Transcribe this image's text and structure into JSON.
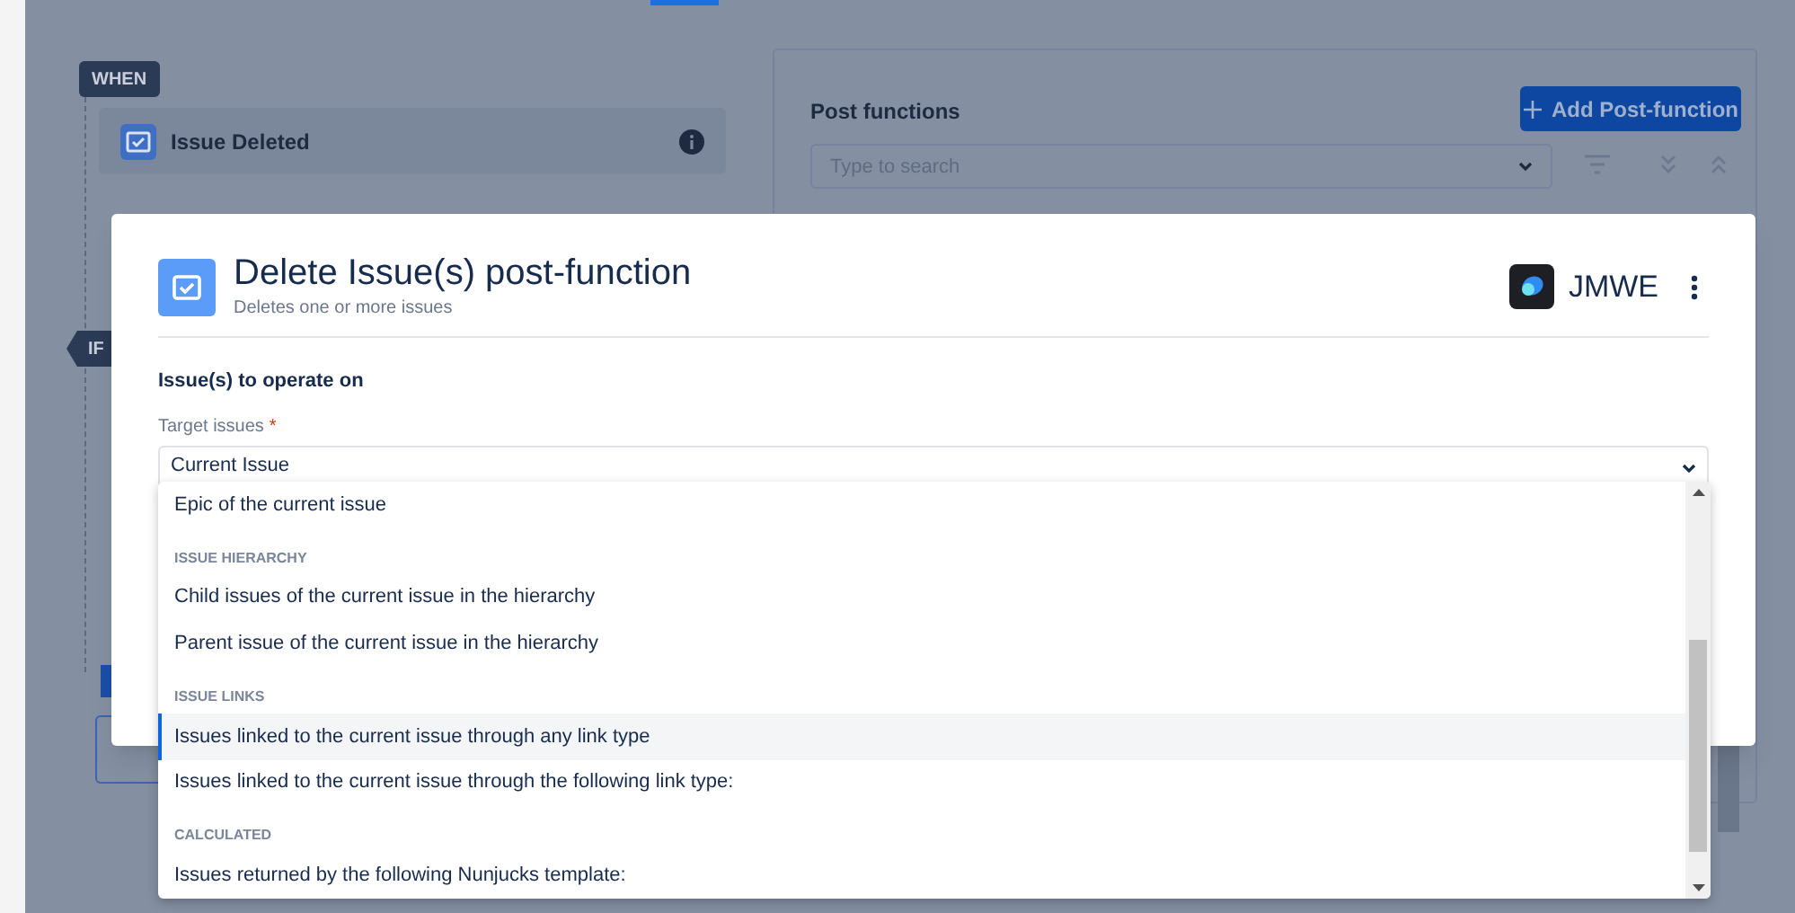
{
  "background": {
    "when_badge": "WHEN",
    "trigger": {
      "title": "Issue Deleted"
    },
    "if_badge": "IF",
    "panel": {
      "title": "Post functions",
      "add_button": "Add Post-function",
      "search": {
        "placeholder": "Type to search"
      }
    }
  },
  "modal": {
    "title": "Delete Issue(s) post-function",
    "subtitle": "Deletes one or more issues",
    "brand": "JMWE",
    "section": "Issue(s) to operate on",
    "field": {
      "label": "Target issues",
      "required_mark": "*",
      "value": "Current Issue"
    },
    "options": [
      {
        "kind": "option",
        "label": "Epic of the current issue",
        "selected": false
      },
      {
        "kind": "group",
        "label": "ISSUE HIERARCHY"
      },
      {
        "kind": "option",
        "label": "Child issues of the current issue in the hierarchy",
        "selected": false
      },
      {
        "kind": "option",
        "label": "Parent issue of the current issue in the hierarchy",
        "selected": false
      },
      {
        "kind": "group",
        "label": "ISSUE LINKS"
      },
      {
        "kind": "option",
        "label": "Issues linked to the current issue through any link type",
        "selected": true
      },
      {
        "kind": "option",
        "label": "Issues linked to the current issue through the following link type:",
        "selected": false
      },
      {
        "kind": "group",
        "label": "CALCULATED"
      },
      {
        "kind": "option",
        "label": "Issues returned by the following Nunjucks template:",
        "selected": false
      }
    ]
  }
}
